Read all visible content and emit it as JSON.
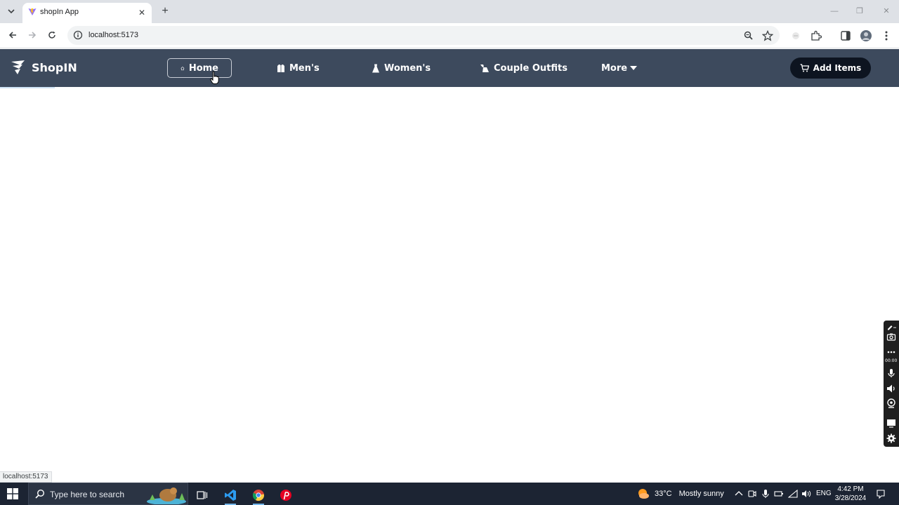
{
  "browser": {
    "tab_title": "shopIn App",
    "url": "localhost:5173",
    "status_url": "localhost:5173"
  },
  "app": {
    "brand": "ShopIN",
    "nav": [
      {
        "label": "Home",
        "icon": "home-icon"
      },
      {
        "label": "Men's",
        "icon": "shirt-icon"
      },
      {
        "label": "Women's",
        "icon": "dress-icon"
      },
      {
        "label": "Couple Outfits",
        "icon": "couple-icon"
      },
      {
        "label": "More",
        "icon": "caret-down-icon"
      }
    ],
    "add_items_label": "Add Items",
    "navbar_color": "#3d4a5d",
    "button_color": "#0d1420"
  },
  "recorder": {
    "time": "00:00"
  },
  "taskbar": {
    "search_placeholder": "Type here to search",
    "weather_temp": "33°C",
    "weather_text": "Mostly sunny",
    "language": "ENG",
    "time": "4:42 PM",
    "date": "3/28/2024"
  }
}
